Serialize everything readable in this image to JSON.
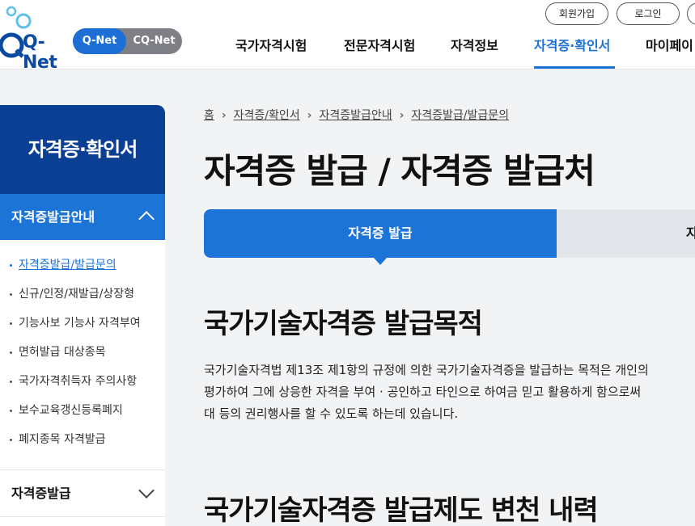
{
  "header": {
    "logo_text": "Q-Net",
    "switch": {
      "qnet": "Q-Net",
      "cqnet": "CQ-Net"
    },
    "top_buttons": {
      "signup": "회원가입",
      "login": "로그인"
    },
    "nav": [
      "국가자격시험",
      "전문자격시험",
      "자격정보",
      "자격증·확인서",
      "마이페이"
    ],
    "active_nav": "자격증·확인서"
  },
  "sidebar": {
    "title": "자격증·확인서",
    "section": "자격증발급안내",
    "items": [
      "자격증발급/발급문의",
      "신규/인정/재발급/상장형",
      "기능사보 기능사 자격부여",
      "면허발급 대상종목",
      "국가자격취득자 주의사항",
      "보수교육갱신등록폐지",
      "폐지종목 자격발급"
    ],
    "active_item": "자격증발급/발급문의",
    "section2": "자격증발급"
  },
  "breadcrumb": [
    "홈",
    "자격증/확인서",
    "자격증발급안내",
    "자격증발급/발급문의"
  ],
  "page_title": "자격증 발급 / 자격증 발급처",
  "tabs": {
    "active": "자격증 발급",
    "next": "자"
  },
  "content": {
    "heading1": "국가기술자격증 발급목적",
    "paragraph": [
      "국가기술자격법 제13조 제1항의 규정에 의한 국가기술자격증을 발급하는 목적은 개인의",
      "평가하여 그에 상응한 자격을 부여 · 공인하고 타인으로 하여금 믿고 활용하게 함으로써 ",
      "대 등의 권리행사를 할 수 있도록 하는데 있습니다."
    ],
    "heading2": "국가기술자격증 발급제도 변천 내력"
  },
  "colors": {
    "primary": "#1c74d6",
    "navy": "#0b3f94",
    "tab_inactive": "#e2e5ea"
  }
}
